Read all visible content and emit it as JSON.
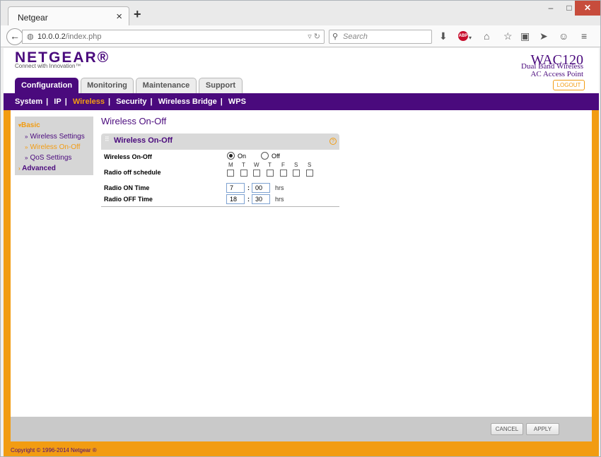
{
  "browser": {
    "tab_title": "Netgear",
    "tab_close": "×",
    "new_tab": "+",
    "window_controls": {
      "minimize": "‒",
      "maximize": "□",
      "close": "✕"
    },
    "url_host": "10.0.0.2",
    "url_path": "/index.php",
    "search_placeholder": "Search"
  },
  "header": {
    "logo": "NETGEAR®",
    "logo_tagline": "Connect with Innovation™",
    "model": "WAC120",
    "model_desc_1": "Dual Band Wireless",
    "model_desc_2": "AC Access Point",
    "logout": "LOGOUT"
  },
  "main_tabs": [
    {
      "label": "Configuration",
      "active": true
    },
    {
      "label": "Monitoring"
    },
    {
      "label": "Maintenance"
    },
    {
      "label": "Support"
    }
  ],
  "sub_nav": [
    {
      "label": "System"
    },
    {
      "label": "IP"
    },
    {
      "label": "Wireless",
      "active": true
    },
    {
      "label": "Security"
    },
    {
      "label": "Wireless Bridge"
    },
    {
      "label": "WPS"
    }
  ],
  "left_menu": {
    "basic": "Basic",
    "items": [
      "Wireless Settings",
      "Wireless On-Off",
      "QoS Settings"
    ],
    "active_item": "Wireless On-Off",
    "advanced": "Advanced"
  },
  "page_title": "Wireless On-Off",
  "panel": {
    "title": "Wireless On-Off",
    "help": "?",
    "wireless_onoff_label": "Wireless On-Off",
    "option_on": "On",
    "option_off": "Off",
    "selected": "On",
    "schedule_label": "Radio off schedule",
    "days": [
      "M",
      "T",
      "W",
      "T",
      "F",
      "S",
      "S"
    ],
    "days_checked": [
      false,
      false,
      false,
      false,
      false,
      false,
      false
    ],
    "on_time_label": "Radio ON Time",
    "on_hour": "7",
    "on_min": "00",
    "off_time_label": "Radio OFF Time",
    "off_hour": "18",
    "off_min": "30",
    "colon": ":",
    "hrs": "hrs"
  },
  "footer": {
    "cancel": "CANCEL",
    "apply": "APPLY",
    "copyright": "Copyright © 1996-2014 Netgear ®"
  },
  "colors": {
    "brand_purple": "#4a0a7d",
    "accent_orange": "#f29c12"
  }
}
